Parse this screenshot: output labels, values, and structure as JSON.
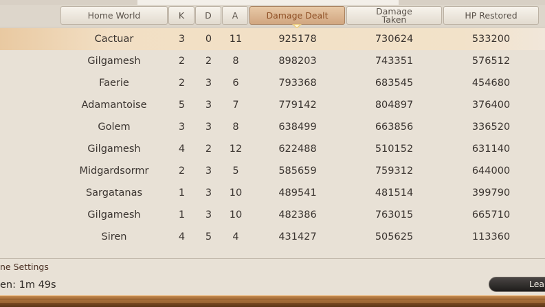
{
  "columns": {
    "home_world": "Home World",
    "k": "K",
    "d": "D",
    "a": "A",
    "damage_dealt": "Damage Dealt",
    "damage_taken": "Damage Taken",
    "hp_restored": "HP Restored"
  },
  "sorted_column": "damage_dealt",
  "rows": [
    {
      "world": "Cactuar",
      "k": "3",
      "d": "0",
      "a": "11",
      "dealt": "925178",
      "taken": "730624",
      "hp": "533200"
    },
    {
      "world": "Gilgamesh",
      "k": "2",
      "d": "2",
      "a": "8",
      "dealt": "898203",
      "taken": "743351",
      "hp": "576512"
    },
    {
      "world": "Faerie",
      "k": "2",
      "d": "3",
      "a": "6",
      "dealt": "793368",
      "taken": "683545",
      "hp": "454680"
    },
    {
      "world": "Adamantoise",
      "k": "5",
      "d": "3",
      "a": "7",
      "dealt": "779142",
      "taken": "804897",
      "hp": "376400"
    },
    {
      "world": "Golem",
      "k": "3",
      "d": "3",
      "a": "8",
      "dealt": "638499",
      "taken": "663856",
      "hp": "336520"
    },
    {
      "world": "Gilgamesh",
      "k": "4",
      "d": "2",
      "a": "12",
      "dealt": "622488",
      "taken": "510152",
      "hp": "631140"
    },
    {
      "world": "Midgardsormr",
      "k": "2",
      "d": "3",
      "a": "5",
      "dealt": "585659",
      "taken": "759312",
      "hp": "644000"
    },
    {
      "world": "Sargatanas",
      "k": "1",
      "d": "3",
      "a": "10",
      "dealt": "489541",
      "taken": "481514",
      "hp": "399790"
    },
    {
      "world": "Gilgamesh",
      "k": "1",
      "d": "3",
      "a": "10",
      "dealt": "482386",
      "taken": "763015",
      "hp": "665710"
    },
    {
      "world": "Siren",
      "k": "4",
      "d": "5",
      "a": "4",
      "dealt": "431427",
      "taken": "505625",
      "hp": "113360"
    }
  ],
  "highlighted_row": 0,
  "footer": {
    "settings_text": "ne Settings",
    "timer_text": "en: 1m 49s",
    "leave_label": "Lea"
  },
  "colors": {
    "accent_header": "#d1a680",
    "accent_text": "#8e4f24",
    "highlight_row": "#f2dfc4"
  }
}
